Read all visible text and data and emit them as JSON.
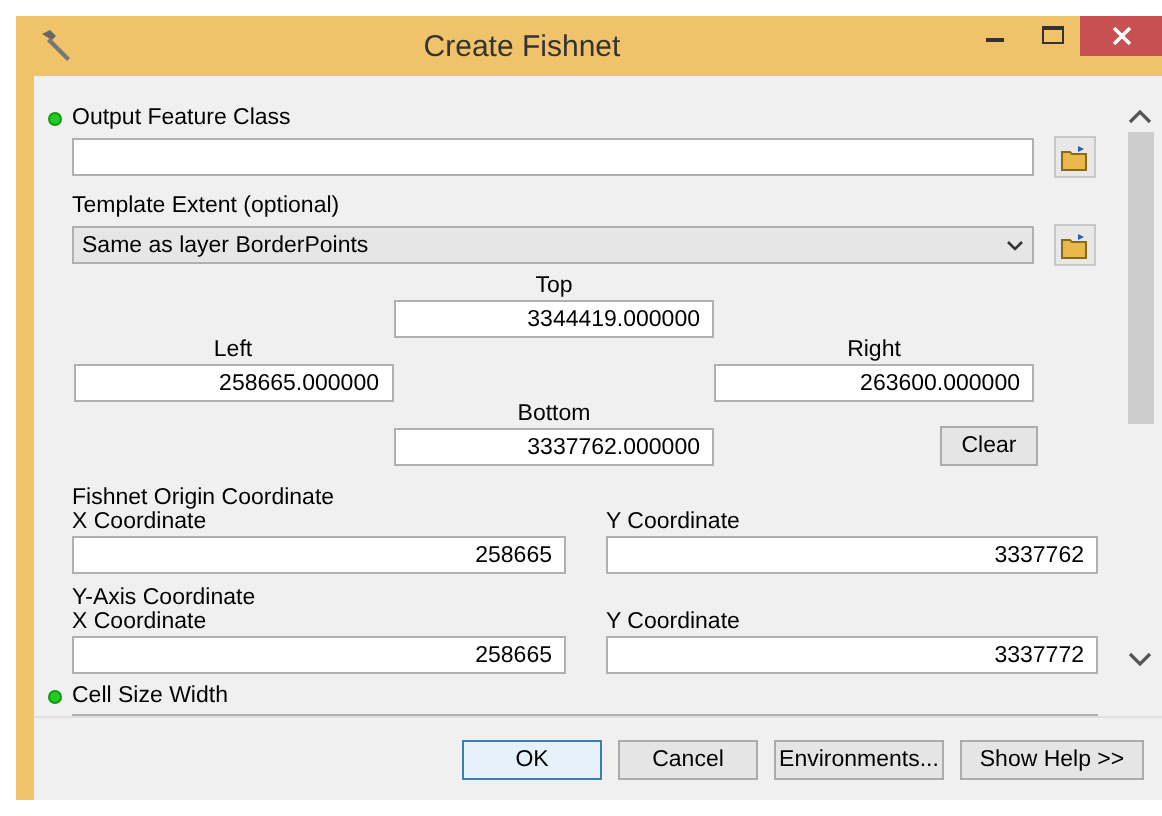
{
  "window": {
    "title": "Create Fishnet"
  },
  "output_feature_class": {
    "label": "Output Feature Class",
    "required": true
  },
  "template_extent": {
    "label": "Template Extent (optional)",
    "required": false,
    "value": "Same as layer BorderPoints"
  },
  "extent": {
    "top": {
      "label": "Top",
      "value": "3344419.000000"
    },
    "left": {
      "label": "Left",
      "value": "258665.000000"
    },
    "right": {
      "label": "Right",
      "value": "263600.000000"
    },
    "bottom": {
      "label": "Bottom",
      "value": "3337762.000000"
    },
    "clear_button": "Clear"
  },
  "fishnet_origin": {
    "label": "Fishnet Origin Coordinate",
    "x": {
      "label": "X Coordinate",
      "value": "258665"
    },
    "y": {
      "label": "Y Coordinate",
      "value": "3337762"
    }
  },
  "y_axis": {
    "label": "Y-Axis Coordinate",
    "x": {
      "label": "X Coordinate",
      "value": "258665"
    },
    "y": {
      "label": "Y Coordinate",
      "value": "3337772"
    }
  },
  "cell_size_width": {
    "label": "Cell Size Width",
    "required": true
  },
  "buttons": [
    {
      "label": "OK",
      "default": true
    },
    {
      "label": "Cancel",
      "default": false
    },
    {
      "label": "Environments...",
      "default": false
    },
    {
      "label": "Show Help >>",
      "default": false
    }
  ]
}
